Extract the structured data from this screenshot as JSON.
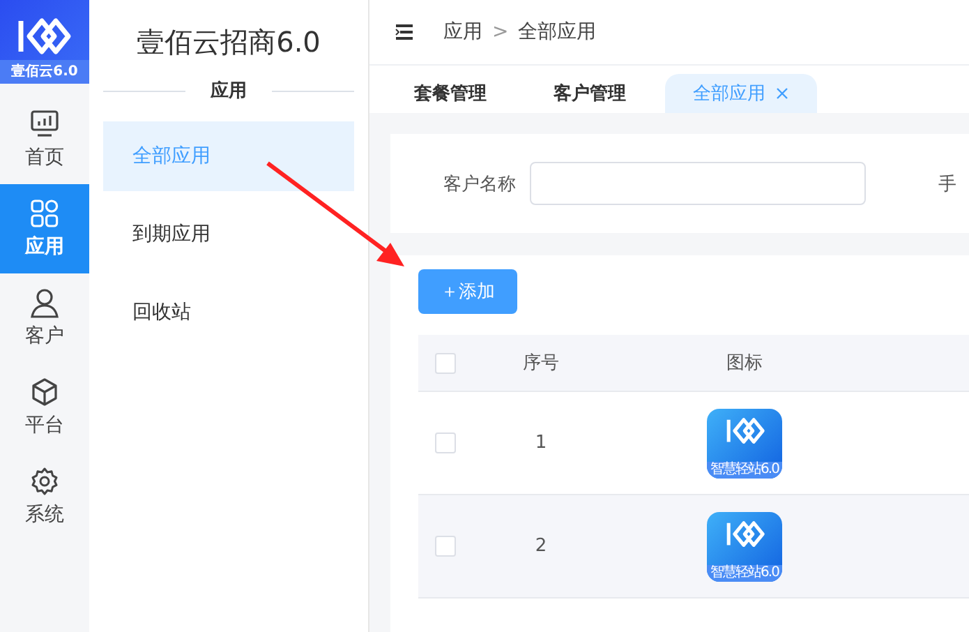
{
  "logo": {
    "caption": "壹佰云6.0"
  },
  "rail": [
    {
      "label": "首页",
      "kind": "monitor",
      "selected": false
    },
    {
      "label": "应用",
      "kind": "grid",
      "selected": true
    },
    {
      "label": "客户",
      "kind": "user",
      "selected": false
    },
    {
      "label": "平台",
      "kind": "cube",
      "selected": false
    },
    {
      "label": "系统",
      "kind": "gear",
      "selected": false
    }
  ],
  "submenu": {
    "title": "壹佰云招商6.0",
    "section": "应用",
    "items": [
      {
        "label": "全部应用",
        "selected": true
      },
      {
        "label": "到期应用",
        "selected": false
      },
      {
        "label": "回收站",
        "selected": false
      }
    ]
  },
  "breadcrumb": [
    "应用",
    "全部应用"
  ],
  "breadcrumb_separator": ">",
  "tabs": [
    {
      "label": "套餐管理",
      "selected": false,
      "closable": false
    },
    {
      "label": "客户管理",
      "selected": false,
      "closable": false
    },
    {
      "label": "全部应用",
      "selected": true,
      "closable": true
    }
  ],
  "filters": [
    {
      "label": "客户名称"
    },
    {
      "label": "手"
    }
  ],
  "add_button": "＋添加",
  "table": {
    "columns": [
      "序号",
      "图标"
    ],
    "all_checked": false,
    "rows": [
      {
        "index": "1",
        "checked": false,
        "icon_caption": "智慧轻站6.0"
      },
      {
        "index": "2",
        "checked": false,
        "icon_caption": "智慧轻站6.0"
      }
    ]
  },
  "annotation": {
    "kind": "arrow"
  }
}
